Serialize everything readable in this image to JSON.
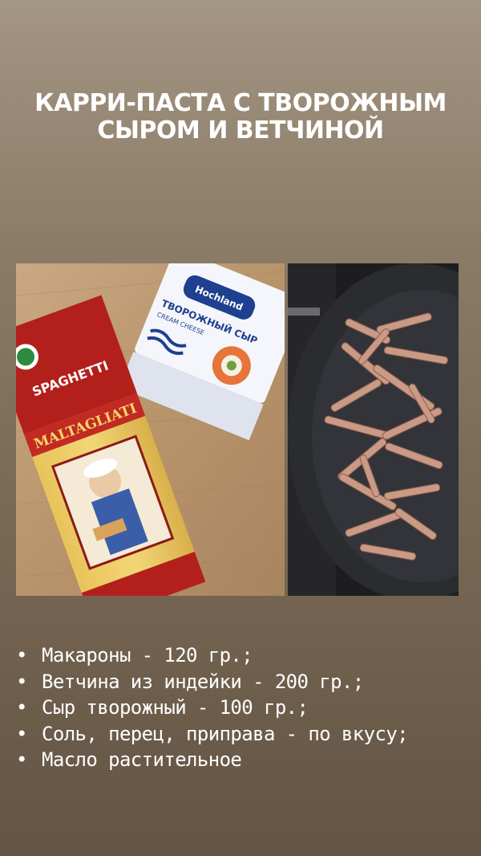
{
  "title_lines": [
    "КАРРИ-ПАСТА С ТВОРОЖНЫМ",
    "СЫРОМ И ВЕТЧИНОЙ"
  ],
  "photo_left": {
    "spaghetti_label": "SPAGHETTI",
    "spaghetti_brand": "MALTAGLIATI",
    "cheese_brand": "Hochland",
    "cheese_name": "ТВОРОЖНЫЙ СЫР",
    "cheese_subname": "CREAM CHEESE"
  },
  "bullet_glyph": "•",
  "ingredients": [
    "Макароны - 120 гр.;",
    "Ветчина из индейки - 200 гр.;",
    "Сыр творожный - 100 гр.;",
    "Соль, перец, приправа - по вкусу;",
    "Масло растительное"
  ],
  "colors": {
    "background_top": "#a49684",
    "background_bottom": "#635444",
    "text": "#ffffff",
    "spaghetti_red": "#b3201c",
    "cheese_blue": "#1f3f8f"
  }
}
